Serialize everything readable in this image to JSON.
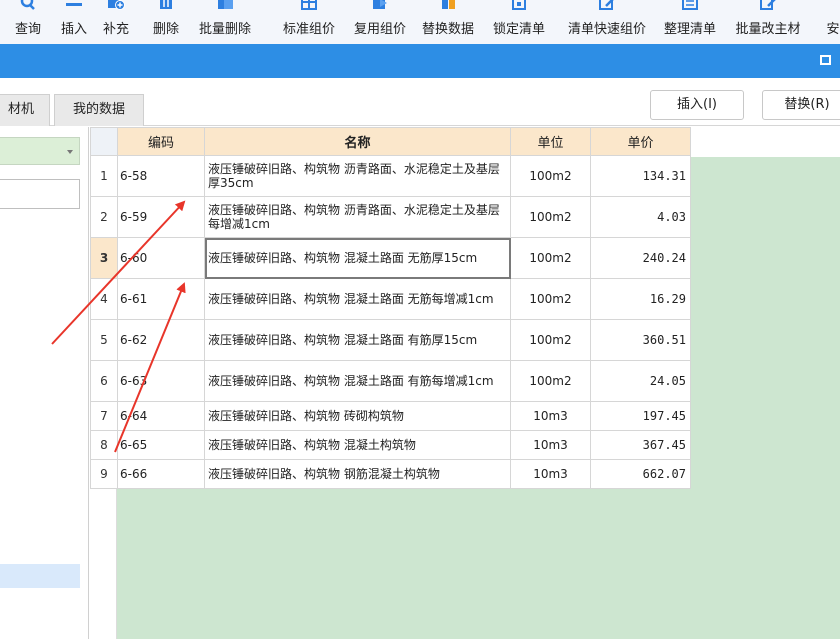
{
  "toolbar": {
    "items": [
      {
        "label": "查询",
        "icon": "search-icon"
      },
      {
        "label": "插入",
        "icon": "insert-icon"
      },
      {
        "label": "补充",
        "icon": "add-icon"
      },
      {
        "label": "删除",
        "icon": "delete-icon"
      },
      {
        "label": "批量删除",
        "icon": "batch-delete-icon"
      },
      {
        "label": "标准组价",
        "icon": "standard-price-icon"
      },
      {
        "label": "复用组价",
        "icon": "reuse-price-icon"
      },
      {
        "label": "替换数据",
        "icon": "replace-data-icon"
      },
      {
        "label": "锁定清单",
        "icon": "lock-icon"
      },
      {
        "label": "清单快速组价",
        "icon": "quick-price-icon"
      },
      {
        "label": "整理清单",
        "icon": "organize-list-icon"
      },
      {
        "label": "批量改主材",
        "icon": "batch-edit-icon"
      },
      {
        "label": "安",
        "icon": "install-icon"
      }
    ],
    "icon_color": "#2d7fe0"
  },
  "titlebar": {
    "color": "#2d8ee5",
    "restore_icon": "window-restore-icon"
  },
  "tabs": [
    {
      "label": "材机"
    },
    {
      "label": "我的数据"
    }
  ],
  "buttons": {
    "insert": "插入(I)",
    "replace": "替换(R)"
  },
  "grid": {
    "columns": [
      "编码",
      "名称",
      "单位",
      "单价"
    ],
    "rows": [
      {
        "num": "1",
        "code": "6-58",
        "name": "液压锤破碎旧路、构筑物 沥青路面、水泥稳定土及基层 厚35cm",
        "unit": "100m2",
        "price": "134.31"
      },
      {
        "num": "2",
        "code": "6-59",
        "name": "液压锤破碎旧路、构筑物 沥青路面、水泥稳定土及基层 每增减1cm",
        "unit": "100m2",
        "price": "4.03"
      },
      {
        "num": "3",
        "code": "6-60",
        "name": "液压锤破碎旧路、构筑物 混凝土路面 无筋厚15cm",
        "unit": "100m2",
        "price": "240.24"
      },
      {
        "num": "4",
        "code": "6-61",
        "name": "液压锤破碎旧路、构筑物 混凝土路面 无筋每增减1cm",
        "unit": "100m2",
        "price": "16.29"
      },
      {
        "num": "5",
        "code": "6-62",
        "name": "液压锤破碎旧路、构筑物 混凝土路面 有筋厚15cm",
        "unit": "100m2",
        "price": "360.51"
      },
      {
        "num": "6",
        "code": "6-63",
        "name": "液压锤破碎旧路、构筑物 混凝土路面 有筋每增减1cm",
        "unit": "100m2",
        "price": "24.05"
      },
      {
        "num": "7",
        "code": "6-64",
        "name": "液压锤破碎旧路、构筑物 砖砌构筑物",
        "unit": "10m3",
        "price": "197.45"
      },
      {
        "num": "8",
        "code": "6-65",
        "name": "液压锤破碎旧路、构筑物 混凝土构筑物",
        "unit": "10m3",
        "price": "367.45"
      },
      {
        "num": "9",
        "code": "6-66",
        "name": "液压锤破碎旧路、构筑物 钢筋混凝土构筑物",
        "unit": "10m3",
        "price": "662.07"
      }
    ],
    "selected_row": "3",
    "header_color": "#fbe7cb",
    "empty_area_color": "#cde6d0"
  },
  "annotation": {
    "arrow_color": "#e8352a"
  }
}
